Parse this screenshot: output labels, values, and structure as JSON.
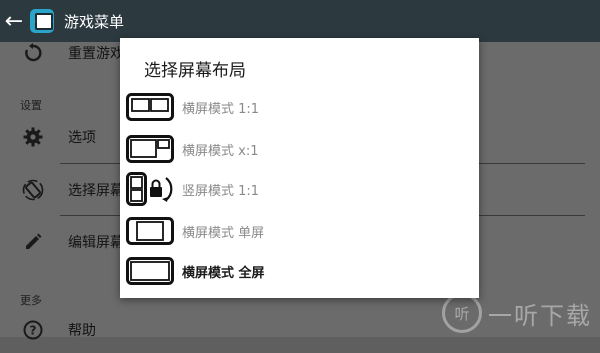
{
  "app": {
    "title": "游戏菜单",
    "back_icon": "arrow-left-icon",
    "logo_icon": "app-logo-icon"
  },
  "menu": {
    "top_partial": {
      "label": "重置游戏",
      "icon": "reset-icon"
    },
    "section_settings": "设置",
    "items": [
      {
        "label": "选项",
        "icon": "gear-icon"
      },
      {
        "label": "选择屏幕布局",
        "icon": "screen-rotate-icon"
      },
      {
        "label": "编辑屏幕布局",
        "icon": "pencil-icon"
      }
    ],
    "section_more": "更多",
    "help": {
      "label": "帮助",
      "icon": "help-icon"
    }
  },
  "dialog": {
    "title": "选择屏幕布局",
    "options": [
      {
        "label": "横屏模式 1:1",
        "icon": "layout-landscape-1-1-icon"
      },
      {
        "label": "横屏模式 x:1",
        "icon": "layout-landscape-x-1-icon"
      },
      {
        "label": "竖屏模式 1:1",
        "icon": "layout-portrait-1-1-lock-icon"
      },
      {
        "label": "横屏模式 单屏",
        "icon": "layout-landscape-single-icon"
      },
      {
        "label": "横屏模式 全屏",
        "icon": "layout-landscape-fullscreen-icon"
      }
    ]
  },
  "watermark": {
    "text": "一听下载",
    "mark_glyph": "听"
  }
}
